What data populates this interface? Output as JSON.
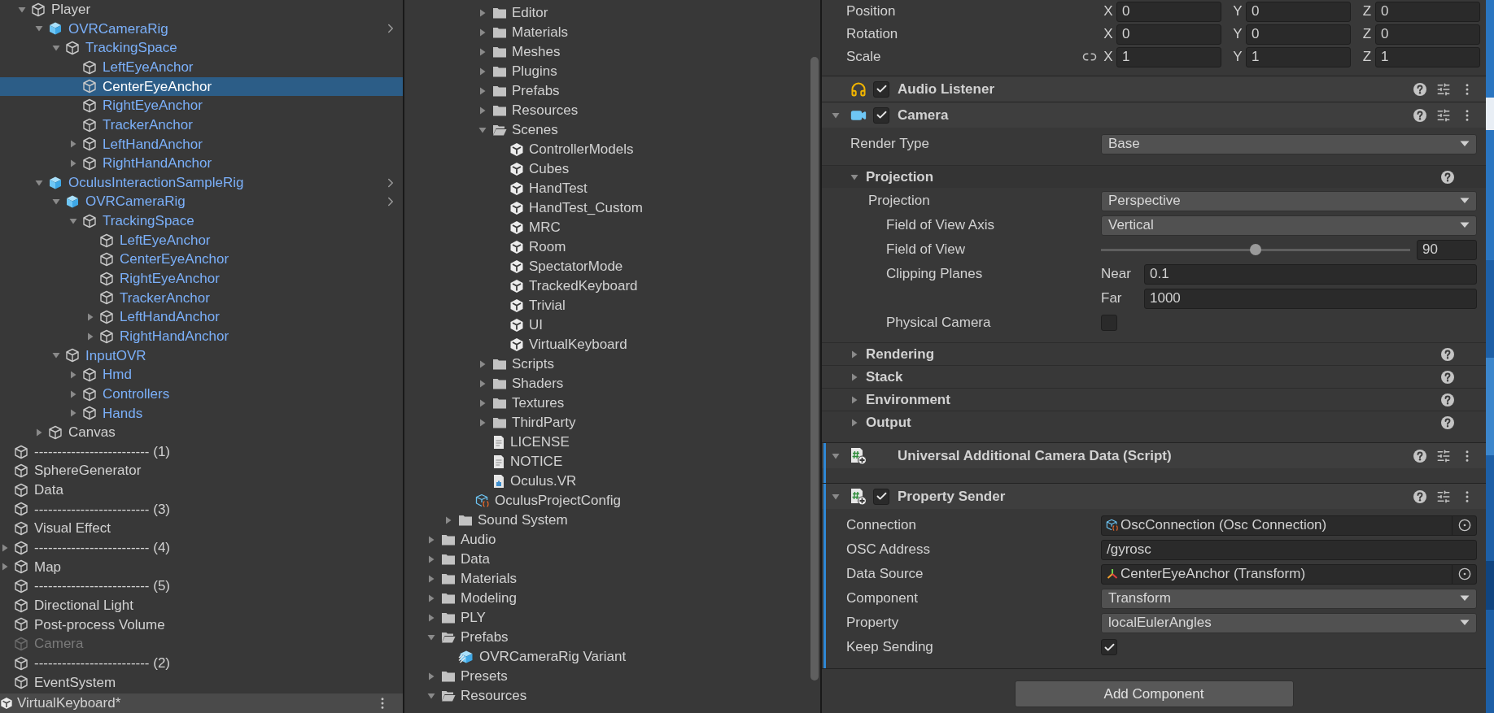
{
  "hierarchy": {
    "items": [
      {
        "children": [
          {
            "name": "Player",
            "kind": "object",
            "active": true,
            "selected": false,
            "expanded": true,
            "children": [
              {
                "name": "OVRCameraRig",
                "kind": "prefab_root",
                "active": true,
                "selected": false,
                "expanded": true,
                "children": [
                  {
                    "name": "TrackingSpace",
                    "kind": "prefab",
                    "active": true,
                    "selected": false,
                    "expanded": true,
                    "children": [
                      {
                        "name": "LeftEyeAnchor",
                        "kind": "prefab",
                        "active": true,
                        "selected": false
                      },
                      {
                        "name": "CenterEyeAnchor",
                        "kind": "prefab",
                        "active": true,
                        "selected": true
                      },
                      {
                        "name": "RightEyeAnchor",
                        "kind": "prefab",
                        "active": true,
                        "selected": false
                      },
                      {
                        "name": "TrackerAnchor",
                        "kind": "prefab",
                        "active": true,
                        "selected": false
                      },
                      {
                        "name": "LeftHandAnchor",
                        "kind": "prefab",
                        "active": true,
                        "selected": false,
                        "expanded": false
                      },
                      {
                        "name": "RightHandAnchor",
                        "kind": "prefab",
                        "active": true,
                        "selected": false,
                        "expanded": false
                      }
                    ]
                  }
                ]
              },
              {
                "name": "OculusInteractionSampleRig",
                "kind": "prefab_root",
                "active": true,
                "selected": false,
                "expanded": true,
                "children": [
                  {
                    "name": "OVRCameraRig",
                    "kind": "prefab_root",
                    "active": true,
                    "selected": false,
                    "expanded": true,
                    "children": [
                      {
                        "name": "TrackingSpace",
                        "kind": "prefab",
                        "active": true,
                        "selected": false,
                        "expanded": true,
                        "children": [
                          {
                            "name": "LeftEyeAnchor",
                            "kind": "prefab",
                            "active": true,
                            "selected": false
                          },
                          {
                            "name": "CenterEyeAnchor",
                            "kind": "prefab",
                            "active": true,
                            "selected": false
                          },
                          {
                            "name": "RightEyeAnchor",
                            "kind": "prefab",
                            "active": true,
                            "selected": false
                          },
                          {
                            "name": "TrackerAnchor",
                            "kind": "prefab",
                            "active": true,
                            "selected": false
                          },
                          {
                            "name": "LeftHandAnchor",
                            "kind": "prefab",
                            "active": true,
                            "selected": false,
                            "expanded": false
                          },
                          {
                            "name": "RightHandAnchor",
                            "kind": "prefab",
                            "active": true,
                            "selected": false,
                            "expanded": false
                          }
                        ]
                      }
                    ]
                  },
                  {
                    "name": "InputOVR",
                    "kind": "prefab",
                    "active": true,
                    "selected": false,
                    "expanded": true,
                    "children": [
                      {
                        "name": "Hmd",
                        "kind": "prefab",
                        "active": true,
                        "selected": false,
                        "expanded": false
                      },
                      {
                        "name": "Controllers",
                        "kind": "prefab",
                        "active": true,
                        "selected": false,
                        "expanded": false
                      },
                      {
                        "name": "Hands",
                        "kind": "prefab",
                        "active": true,
                        "selected": false,
                        "expanded": false
                      }
                    ]
                  }
                ]
              },
              {
                "name": "Canvas",
                "kind": "object",
                "active": true,
                "selected": false,
                "expanded": false
              }
            ]
          }
        ]
      },
      {
        "name": "------------------------- (1)",
        "kind": "object",
        "active": true,
        "selected": false
      },
      {
        "name": "SphereGenerator",
        "kind": "object",
        "active": true,
        "selected": false
      },
      {
        "name": "Data",
        "kind": "object",
        "active": true,
        "selected": false
      },
      {
        "name": "------------------------- (3)",
        "kind": "object",
        "active": true,
        "selected": false
      },
      {
        "name": "Visual Effect",
        "kind": "object",
        "active": true,
        "selected": false
      },
      {
        "name": "------------------------- (4)",
        "kind": "object",
        "active": true,
        "selected": false,
        "expanded": false
      },
      {
        "name": "Map",
        "kind": "object",
        "active": true,
        "selected": false,
        "expanded": false
      },
      {
        "name": "------------------------- (5)",
        "kind": "object",
        "active": true,
        "selected": false
      },
      {
        "name": "Directional Light",
        "kind": "object",
        "active": true,
        "selected": false
      },
      {
        "name": "Post-process Volume",
        "kind": "object",
        "active": true,
        "selected": false
      },
      {
        "name": "Camera",
        "kind": "object",
        "active": false,
        "selected": false
      },
      {
        "name": "------------------------- (2)",
        "kind": "object",
        "active": true,
        "selected": false
      },
      {
        "name": "EventSystem",
        "kind": "object",
        "active": true,
        "selected": false
      }
    ],
    "scene": {
      "name": "VirtualKeyboard*"
    }
  },
  "project": {
    "items": [
      {
        "children": [
          {
            "children": [
              {
                "children": [
                  {
                    "name": "Editor",
                    "kind": "folder",
                    "selected": false,
                    "expanded": false
                  },
                  {
                    "name": "Materials",
                    "kind": "folder",
                    "selected": false,
                    "expanded": false
                  },
                  {
                    "name": "Meshes",
                    "kind": "folder",
                    "selected": false,
                    "expanded": false
                  },
                  {
                    "name": "Plugins",
                    "kind": "folder",
                    "selected": false,
                    "expanded": false
                  },
                  {
                    "name": "Prefabs",
                    "kind": "folder",
                    "selected": false,
                    "expanded": false
                  },
                  {
                    "name": "Resources",
                    "kind": "folder",
                    "selected": false,
                    "expanded": false
                  },
                  {
                    "name": "Scenes",
                    "kind": "folder",
                    "selected": false,
                    "expanded": true,
                    "children": [
                      {
                        "name": "ControllerModels",
                        "kind": "scene",
                        "selected": false
                      },
                      {
                        "name": "Cubes",
                        "kind": "scene",
                        "selected": false
                      },
                      {
                        "name": "HandTest",
                        "kind": "scene",
                        "selected": false
                      },
                      {
                        "name": "HandTest_Custom",
                        "kind": "scene",
                        "selected": false
                      },
                      {
                        "name": "MRC",
                        "kind": "scene",
                        "selected": false
                      },
                      {
                        "name": "Room",
                        "kind": "scene",
                        "selected": false
                      },
                      {
                        "name": "SpectatorMode",
                        "kind": "scene",
                        "selected": false
                      },
                      {
                        "name": "TrackedKeyboard",
                        "kind": "scene",
                        "selected": false
                      },
                      {
                        "name": "Trivial",
                        "kind": "scene",
                        "selected": false
                      },
                      {
                        "name": "UI",
                        "kind": "scene",
                        "selected": false
                      },
                      {
                        "name": "VirtualKeyboard",
                        "kind": "scene",
                        "selected": false
                      }
                    ]
                  },
                  {
                    "name": "Scripts",
                    "kind": "folder",
                    "selected": false,
                    "expanded": false
                  },
                  {
                    "name": "Shaders",
                    "kind": "folder",
                    "selected": false,
                    "expanded": false
                  },
                  {
                    "name": "Textures",
                    "kind": "folder",
                    "selected": false,
                    "expanded": false
                  },
                  {
                    "name": "ThirdParty",
                    "kind": "folder",
                    "selected": false,
                    "expanded": false
                  },
                  {
                    "name": "LICENSE",
                    "kind": "text",
                    "selected": false
                  },
                  {
                    "name": "NOTICE",
                    "kind": "text",
                    "selected": false
                  },
                  {
                    "name": "Oculus.VR",
                    "kind": "assembly",
                    "selected": false
                  }
                ]
              },
              {
                "name": "OculusProjectConfig",
                "kind": "config",
                "selected": false
              }
            ]
          },
          {
            "name": "Sound System",
            "kind": "folder",
            "selected": false,
            "expanded": false
          }
        ]
      },
      {
        "name": "Audio",
        "kind": "folder",
        "selected": false,
        "expanded": false
      },
      {
        "name": "Data",
        "kind": "folder",
        "selected": false,
        "expanded": false
      },
      {
        "name": "Materials",
        "kind": "folder",
        "selected": false,
        "expanded": false
      },
      {
        "name": "Modeling",
        "kind": "folder",
        "selected": false,
        "expanded": false
      },
      {
        "name": "PLY",
        "kind": "folder",
        "selected": false,
        "expanded": false
      },
      {
        "name": "Prefabs",
        "kind": "folder",
        "selected": false,
        "expanded": true,
        "children": [
          {
            "name": "OVRCameraRig Variant",
            "kind": "prefab_variant",
            "selected": false
          }
        ]
      },
      {
        "name": "Presets",
        "kind": "folder",
        "selected": false,
        "expanded": false
      },
      {
        "name": "Resources",
        "kind": "folder",
        "selected": false,
        "expanded": true
      }
    ]
  },
  "inspector": {
    "transform_rows": [
      {
        "label": "Position",
        "values": [
          {
            "axis": "X",
            "value": "0"
          },
          {
            "axis": "Y",
            "value": "0"
          },
          {
            "axis": "Z",
            "value": "0"
          }
        ]
      },
      {
        "label": "Rotation",
        "values": [
          {
            "axis": "X",
            "value": "0"
          },
          {
            "axis": "Y",
            "value": "0"
          },
          {
            "axis": "Z",
            "value": "0"
          }
        ]
      },
      {
        "label": "Scale",
        "constrain_proportions": false,
        "values": [
          {
            "axis": "X",
            "value": "1"
          },
          {
            "axis": "Y",
            "value": "1"
          },
          {
            "axis": "Z",
            "value": "1"
          }
        ]
      }
    ],
    "components": [
      {
        "kind": "audio_listener",
        "title": "Audio Listener",
        "enabled": true,
        "overridden": false
      },
      {
        "kind": "camera",
        "title": "Camera",
        "enabled": true,
        "expanded": true,
        "overridden": false,
        "properties": [
          {
            "kind": "dropdown",
            "label": "Render Type",
            "value": "Base"
          }
        ],
        "sections": [
          {
            "title": "Projection",
            "expanded": true,
            "properties": [
              {
                "kind": "dropdown",
                "label": "Projection",
                "value": "Perspective",
                "children": [
                  {
                    "kind": "dropdown",
                    "label": "Field of View Axis",
                    "value": "Vertical"
                  },
                  {
                    "kind": "slider",
                    "label": "Field of View",
                    "level": 0.5,
                    "value": "90"
                  },
                  {
                    "kind": "clipping",
                    "label": "Clipping Planes",
                    "near_label": "Near",
                    "near": "0.1",
                    "far_label": "Far",
                    "far": "1000"
                  },
                  {
                    "kind": "checkbox",
                    "label": "Physical Camera",
                    "checked": false
                  }
                ]
              }
            ]
          },
          {
            "title": "Rendering",
            "expanded": false
          },
          {
            "title": "Stack",
            "expanded": false
          },
          {
            "title": "Environment",
            "expanded": false
          },
          {
            "title": "Output",
            "expanded": false
          }
        ]
      },
      {
        "kind": "script",
        "title": "Universal Additional Camera Data (Script)",
        "expanded": true,
        "overridden": true
      },
      {
        "kind": "script",
        "title": "Property Sender",
        "enabled": true,
        "expanded": true,
        "overridden": true,
        "properties": [
          {
            "kind": "asset_ref",
            "label": "Connection",
            "value": "OscConnection (Osc Connection)"
          },
          {
            "kind": "text",
            "label": "OSC Address",
            "value": "/gyrosc"
          },
          {
            "kind": "transform_ref",
            "label": "Data Source",
            "value": "CenterEyeAnchor (Transform)"
          },
          {
            "kind": "dropdown",
            "label": "Component",
            "value": "Transform"
          },
          {
            "kind": "dropdown",
            "label": "Property",
            "value": "localEulerAngles"
          },
          {
            "kind": "checkbox",
            "label": "Keep Sending",
            "checked": true
          }
        ]
      }
    ],
    "add_component": "Add Component"
  }
}
